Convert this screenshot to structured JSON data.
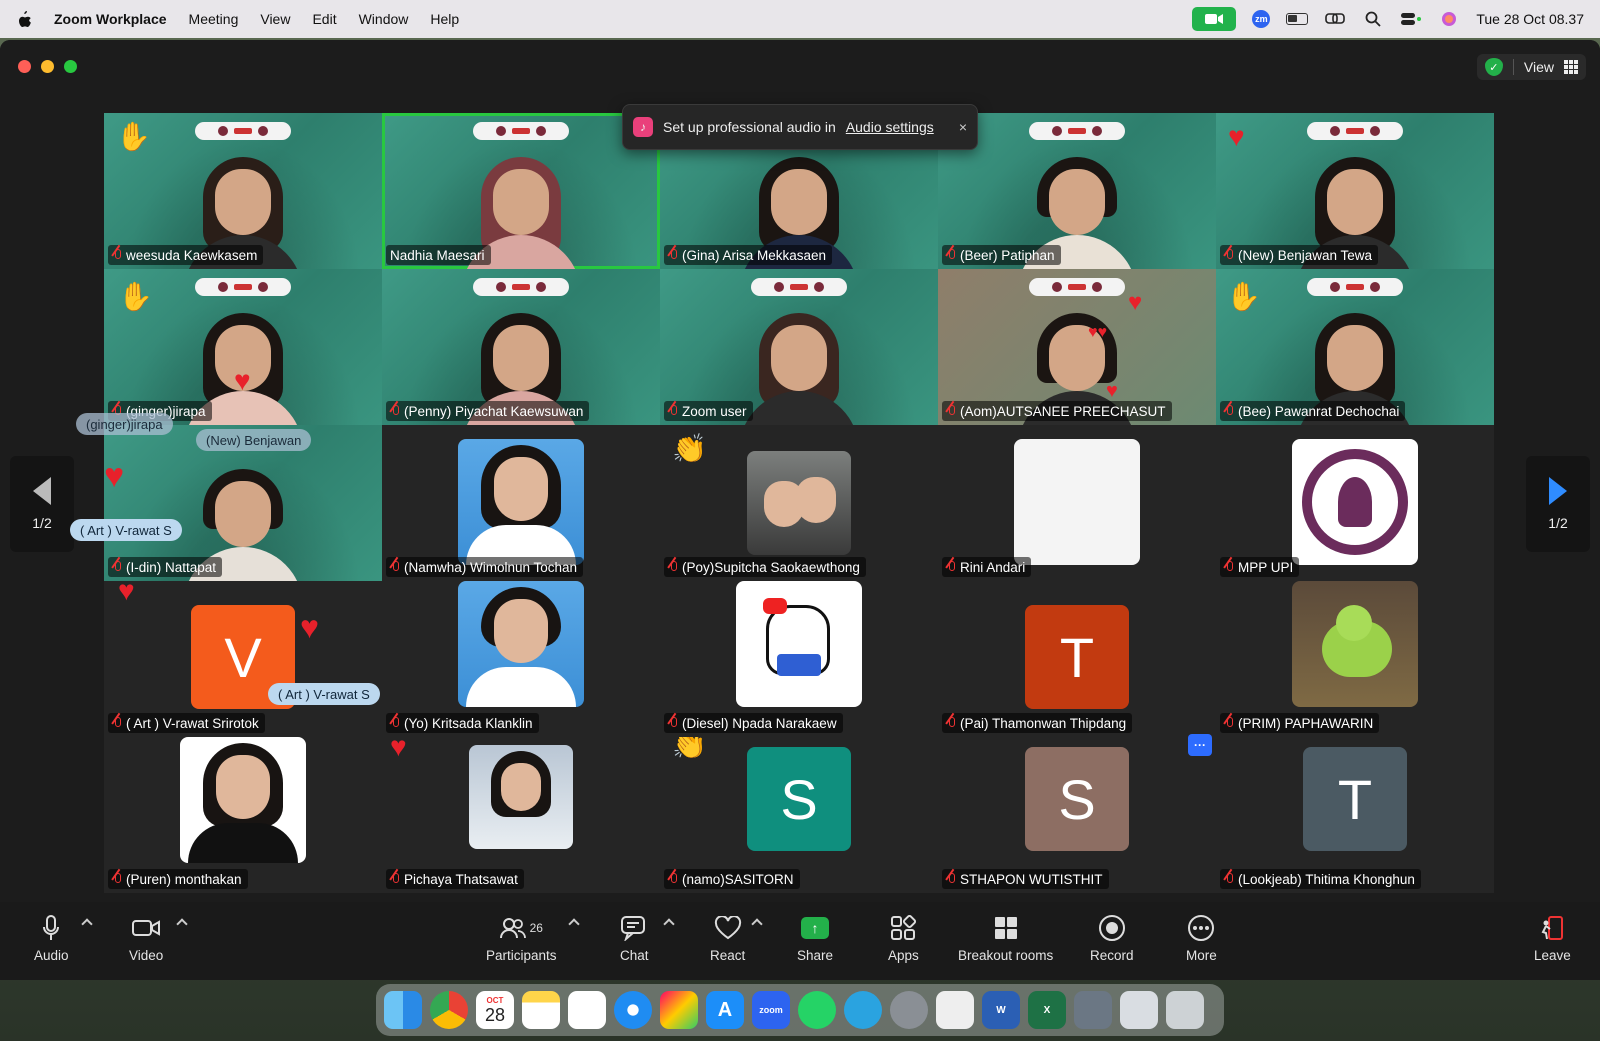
{
  "menubar": {
    "app_name": "Zoom Workplace",
    "items": [
      "Meeting",
      "View",
      "Edit",
      "Window",
      "Help"
    ],
    "zm_label": "zm",
    "clock": "Tue 28 Oct  08.37"
  },
  "window": {
    "view_label": "View"
  },
  "toast": {
    "text": "Set up professional audio in",
    "link": "Audio settings",
    "close": "×"
  },
  "page_nav": {
    "left": "1/2",
    "right": "1/2"
  },
  "tiles": [
    {
      "name": "weesuda Kaewkasem"
    },
    {
      "name": "Nadhia Maesari"
    },
    {
      "name": "(Gina) Arisa Mekkasaen"
    },
    {
      "name": "(Beer) Patiphan"
    },
    {
      "name": "(New) Benjawan Tewa"
    },
    {
      "name": "(ginger)jirapa"
    },
    {
      "name": "(Penny) Piyachat Kaewsuwan"
    },
    {
      "name": "Zoom user"
    },
    {
      "name": "(Aom)AUTSANEE PREECHASUT"
    },
    {
      "name": "(Bee) Pawanrat Dechochai"
    },
    {
      "name": "(I-din) Nattapat"
    },
    {
      "name": "(Namwha) Wimolnun Tochan"
    },
    {
      "name": "(Poy)Supitcha Saokaewthong"
    },
    {
      "name": "Rini Andari"
    },
    {
      "name": "MPP UPI"
    },
    {
      "name": "( Art ) V-rawat Srirotok",
      "letter": "V"
    },
    {
      "name": "(Yo) Kritsada Klanklin"
    },
    {
      "name": "(Diesel) Npada Narakaew"
    },
    {
      "name": "(Pai) Thamonwan Thipdang",
      "letter": "T"
    },
    {
      "name": "(PRIM) PAPHAWARIN"
    },
    {
      "name": "(Puren) monthakan"
    },
    {
      "name": "Pichaya Thatsawat"
    },
    {
      "name": "(namo)SASITORN",
      "letter": "S"
    },
    {
      "name": "STHAPON WUTISTHIT",
      "letter": "S"
    },
    {
      "name": "(Lookjeab) Thitima Khonghun",
      "letter": "T"
    }
  ],
  "floating_names": {
    "ginger": "(ginger)jirapa",
    "new_benjawan": "(New) Benjawan",
    "art1": "( Art ) V-rawat S",
    "art2": "( Art ) V-rawat S"
  },
  "more_badge": "···",
  "toolbar": {
    "audio": "Audio",
    "video": "Video",
    "participants": "Participants",
    "participants_count": "26",
    "chat": "Chat",
    "react": "React",
    "share": "Share",
    "apps": "Apps",
    "breakout": "Breakout rooms",
    "record": "Record",
    "more": "More",
    "leave": "Leave"
  },
  "dock": {
    "calendar_month": "OCT",
    "calendar_day": "28",
    "zoom_label": "zoom"
  },
  "colors": {
    "accent_green": "#28c840",
    "mute_red": "#e33333",
    "letter_v": "#f45b1c",
    "letter_t1": "#c23a10",
    "letter_s1": "#0f8f7e",
    "letter_s2": "#8d6e63",
    "letter_t2": "#4b5a63"
  }
}
